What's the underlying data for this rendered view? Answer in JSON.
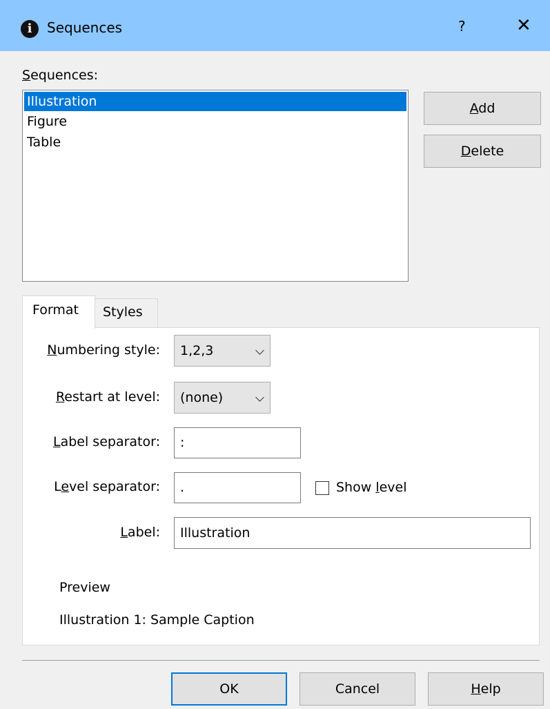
{
  "window": {
    "title": "Sequences",
    "help_glyph": "?",
    "close_glyph": "✕",
    "icon": "info-icon"
  },
  "sequences": {
    "label_mnemonic": "S",
    "label_rest": "equences:",
    "items": [
      {
        "label": "Illustration",
        "selected": true
      },
      {
        "label": "Figure",
        "selected": false
      },
      {
        "label": "Table",
        "selected": false
      }
    ]
  },
  "buttons": {
    "add_mnemonic": "A",
    "add_rest": "dd",
    "delete_mnemonic": "D",
    "delete_rest": "elete",
    "ok": "OK",
    "cancel": "Cancel",
    "help_mnemonic": "H",
    "help_rest": "elp"
  },
  "tabs": {
    "format": "Format",
    "styles": "Styles",
    "active": "Format"
  },
  "format": {
    "numbering_style_label_mnemonic": "N",
    "numbering_style_label_rest": "umbering style:",
    "numbering_style_value": "1,2,3",
    "restart_label_mnemonic": "R",
    "restart_label_rest": "estart at level:",
    "restart_value": "(none)",
    "label_separator_mnemonic": "L",
    "label_separator_rest": "abel separator:",
    "label_separator_value": ":",
    "level_separator_pre": "L",
    "level_separator_mnemonic": "e",
    "level_separator_rest": "vel separator:",
    "level_separator_value": ".",
    "show_level_pre": "Show ",
    "show_level_mnemonic": "l",
    "show_level_rest": "evel",
    "show_level_checked": false,
    "label_label_mnemonic": "L",
    "label_label_rest": "abel:",
    "label_value": "Illustration",
    "preview_title": "Preview",
    "preview_text": "Illustration 1: Sample Caption"
  }
}
